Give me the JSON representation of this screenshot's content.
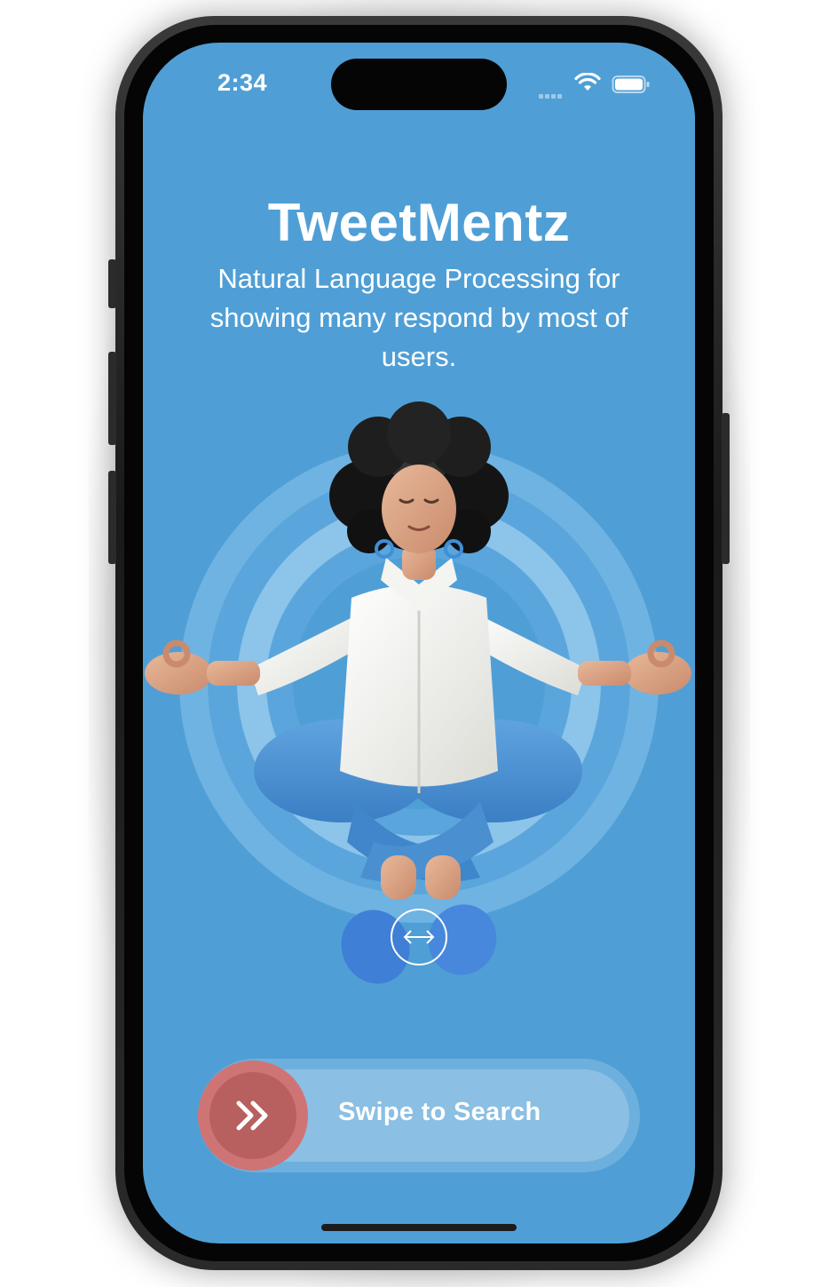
{
  "status_bar": {
    "time": "2:34",
    "icons": [
      "cellular-signal-icon",
      "wifi-icon",
      "battery-icon"
    ]
  },
  "app": {
    "title": "TweetMentz",
    "subtitle": "Natural Language Processing for showing many respond by most of users."
  },
  "hero": {
    "illustration": "meditating-woman-illustration",
    "swipe_hint_icon": "left-right-arrow-icon"
  },
  "swipe": {
    "label": "Swipe to Search",
    "icon": "double-chevron-right-icon"
  },
  "colors": {
    "background": "#4f9fd6",
    "knob": "#cf7474",
    "text": "#ffffff"
  }
}
